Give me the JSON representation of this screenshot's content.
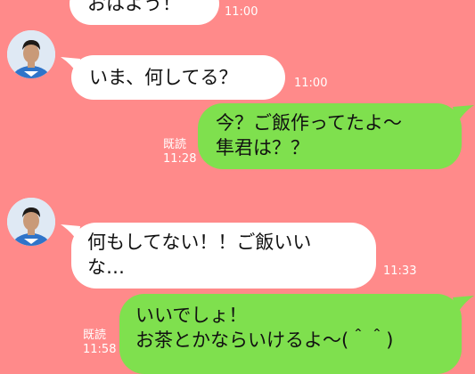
{
  "messages": [
    {
      "direction": "incoming",
      "text": [
        "おはよう！"
      ],
      "time": "11:00"
    },
    {
      "direction": "incoming",
      "text": [
        "いま、何してる？"
      ],
      "time": "11:00"
    },
    {
      "direction": "outgoing",
      "text": [
        "今？ご飯作ってたよ〜",
        "隼君は？？"
      ],
      "read": "既読",
      "time": "11:28"
    },
    {
      "direction": "incoming",
      "text": [
        "何もしてない！！ご飯いい",
        "な…"
      ],
      "time": "11:33"
    },
    {
      "direction": "outgoing",
      "text": [
        "いいでしょ！",
        "お茶とかならいけるよ〜(＾＾)"
      ],
      "read": "既読",
      "time": "11:58"
    }
  ],
  "colors": {
    "background": "#ff8a8a",
    "incoming_bubble": "#ffffff",
    "outgoing_bubble": "#7fe04e",
    "meta_text": "#ffffff"
  },
  "icons": {
    "avatar": "contact-avatar-photo"
  }
}
